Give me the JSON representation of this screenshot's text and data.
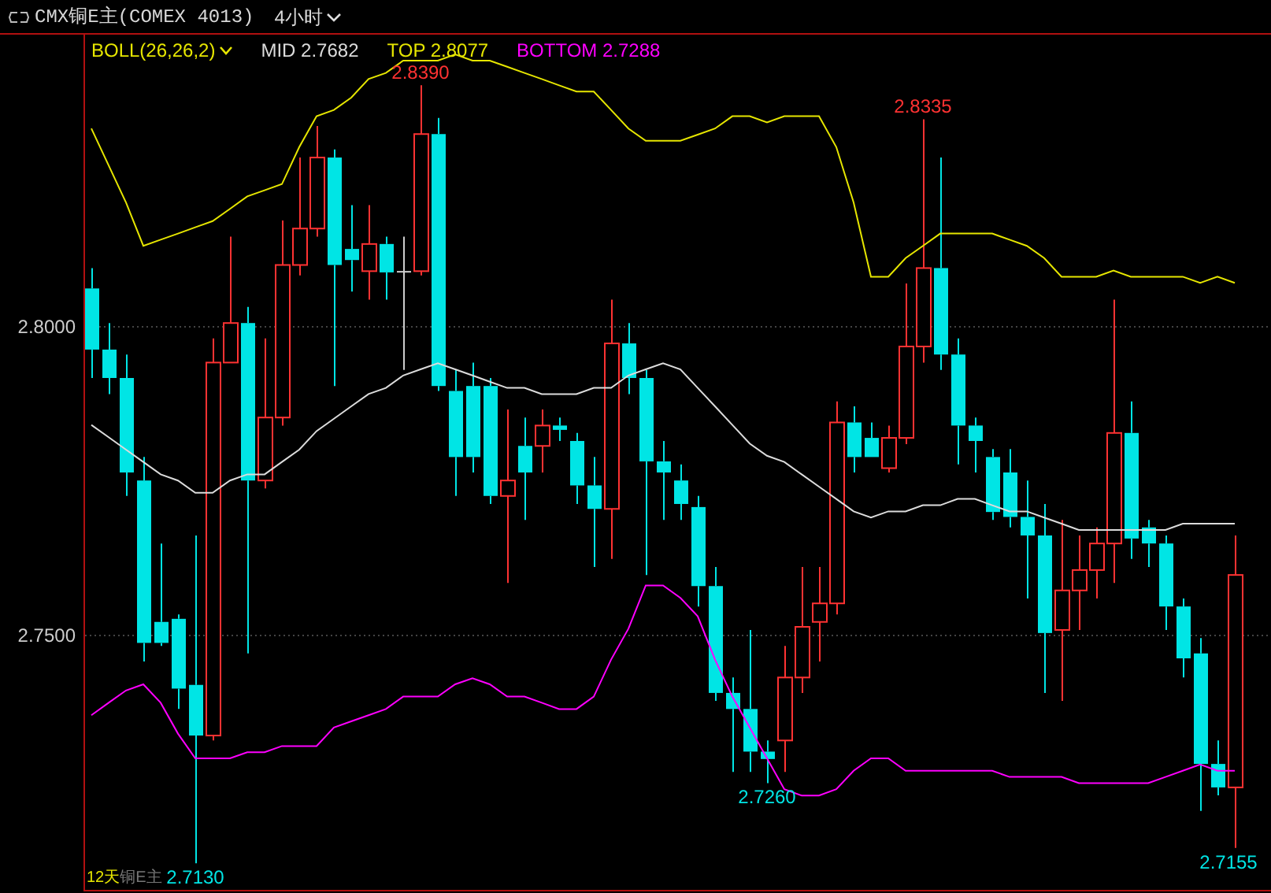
{
  "header": {
    "title": "CMX铜E主(COMEX 4013)",
    "period": "4小时"
  },
  "legend": [
    {
      "kind": "indicator",
      "text": "BOLL(26,26,2)",
      "color": "#e6e600"
    },
    {
      "kind": "value",
      "text": "MID 2.7682",
      "color": "#dcdcdc"
    },
    {
      "kind": "value",
      "text": "TOP 2.8077",
      "color": "#e6e600"
    },
    {
      "kind": "value",
      "text": "BOTTOM 2.7288",
      "color": "#ff00ff"
    }
  ],
  "chart_data": {
    "type": "candlestick",
    "ylim": [
      2.7082,
      2.8472
    ],
    "yticks": [
      {
        "value": 2.8,
        "label": "2.8000"
      },
      {
        "value": 2.75,
        "label": "2.7500"
      }
    ],
    "series": [
      {
        "type": "line",
        "color": "#dcdcdc",
        "values": [
          2.784,
          2.782,
          2.78,
          2.778,
          2.776,
          2.775,
          2.773,
          2.773,
          2.775,
          2.776,
          2.776,
          2.778,
          2.78,
          2.783,
          2.785,
          2.787,
          2.789,
          2.79,
          2.792,
          2.793,
          2.794,
          2.793,
          2.792,
          2.791,
          2.79,
          2.79,
          2.789,
          2.789,
          2.789,
          2.79,
          2.79,
          2.792,
          2.793,
          2.794,
          2.793,
          2.79,
          2.787,
          2.784,
          2.781,
          2.779,
          2.778,
          2.776,
          2.774,
          2.772,
          2.77,
          2.769,
          2.77,
          2.77,
          2.771,
          2.771,
          2.772,
          2.772,
          2.771,
          2.77,
          2.77,
          2.769,
          2.768,
          2.767,
          2.767,
          2.767,
          2.767,
          2.767,
          2.767,
          2.768,
          2.768,
          2.768,
          2.768
        ]
      },
      {
        "type": "line",
        "color": "#e6e600",
        "values": [
          2.832,
          2.826,
          2.82,
          2.813,
          2.814,
          2.815,
          2.816,
          2.817,
          2.819,
          2.821,
          2.822,
          2.823,
          2.829,
          2.834,
          2.835,
          2.837,
          2.84,
          2.841,
          2.843,
          2.843,
          2.843,
          2.844,
          2.843,
          2.843,
          2.842,
          2.841,
          2.84,
          2.839,
          2.838,
          2.838,
          2.835,
          2.832,
          2.83,
          2.83,
          2.83,
          2.831,
          2.832,
          2.834,
          2.834,
          2.833,
          2.834,
          2.834,
          2.834,
          2.829,
          2.82,
          2.808,
          2.808,
          2.811,
          2.813,
          2.815,
          2.815,
          2.815,
          2.815,
          2.814,
          2.813,
          2.811,
          2.808,
          2.808,
          2.808,
          2.809,
          2.808,
          2.808,
          2.808,
          2.808,
          2.807,
          2.808,
          2.807
        ]
      },
      {
        "type": "line",
        "color": "#ff00ff",
        "values": [
          2.737,
          2.739,
          2.741,
          2.742,
          2.739,
          2.734,
          2.73,
          2.73,
          2.73,
          2.731,
          2.731,
          2.732,
          2.732,
          2.732,
          2.735,
          2.736,
          2.737,
          2.738,
          2.74,
          2.74,
          2.74,
          2.742,
          2.743,
          2.742,
          2.74,
          2.74,
          2.739,
          2.738,
          2.738,
          2.74,
          2.746,
          2.751,
          2.758,
          2.758,
          2.756,
          2.753,
          2.746,
          2.74,
          2.735,
          2.73,
          2.725,
          2.724,
          2.724,
          2.725,
          2.728,
          2.73,
          2.73,
          2.728,
          2.728,
          2.728,
          2.728,
          2.728,
          2.728,
          2.727,
          2.727,
          2.727,
          2.727,
          2.726,
          2.726,
          2.726,
          2.726,
          2.726,
          2.727,
          2.728,
          2.729,
          2.728,
          2.728
        ]
      }
    ],
    "ohlc": [
      [
        2.8061,
        2.8094,
        2.7916,
        2.7962
      ],
      [
        2.7962,
        2.8005,
        2.789,
        2.7916
      ],
      [
        2.7916,
        2.7954,
        2.7725,
        2.7763
      ],
      [
        2.775,
        2.7788,
        2.7457,
        2.7487
      ],
      [
        2.7521,
        2.7648,
        2.7482,
        2.7487
      ],
      [
        2.7526,
        2.7533,
        2.738,
        2.7413
      ],
      [
        2.7419,
        2.7661,
        2.713,
        2.7337
      ],
      [
        2.7337,
        2.798,
        2.7329,
        2.7941
      ],
      [
        2.7941,
        2.8145,
        2.7941,
        2.8005
      ],
      [
        2.8005,
        2.8031,
        2.747,
        2.775
      ],
      [
        2.775,
        2.798,
        2.7737,
        2.7852
      ],
      [
        2.7852,
        2.8171,
        2.7839,
        2.8099
      ],
      [
        2.8099,
        2.8273,
        2.8082,
        2.8158
      ],
      [
        2.8158,
        2.8324,
        2.8145,
        2.8273
      ],
      [
        2.8273,
        2.8286,
        2.7903,
        2.8099
      ],
      [
        2.8125,
        2.8196,
        2.8056,
        2.8107
      ],
      [
        2.8089,
        2.8196,
        2.8043,
        2.8133
      ],
      [
        2.8133,
        2.8145,
        2.8043,
        2.8087
      ],
      [
        2.8088,
        2.8145,
        2.7929,
        2.8088
      ],
      [
        2.8089,
        2.839,
        2.8082,
        2.8311
      ],
      [
        2.8311,
        2.8337,
        2.7895,
        2.7903
      ],
      [
        2.7895,
        2.7929,
        2.7725,
        2.7788
      ],
      [
        2.7903,
        2.7941,
        2.7763,
        2.7788
      ],
      [
        2.7903,
        2.7916,
        2.7712,
        2.7725
      ],
      [
        2.7725,
        2.7865,
        2.7584,
        2.775
      ],
      [
        2.7806,
        2.7852,
        2.7686,
        2.7763
      ],
      [
        2.7806,
        2.7865,
        2.7763,
        2.7839
      ],
      [
        2.7839,
        2.7852,
        2.7814,
        2.7832
      ],
      [
        2.7814,
        2.7827,
        2.7712,
        2.7742
      ],
      [
        2.7742,
        2.7788,
        2.761,
        2.7704
      ],
      [
        2.7704,
        2.8043,
        2.7623,
        2.7972
      ],
      [
        2.7972,
        2.8005,
        2.789,
        2.7916
      ],
      [
        2.7916,
        2.7929,
        2.7597,
        2.7781
      ],
      [
        2.7781,
        2.7814,
        2.7686,
        2.7763
      ],
      [
        2.775,
        2.7776,
        2.7686,
        2.7712
      ],
      [
        2.7707,
        2.7725,
        2.7546,
        2.7579
      ],
      [
        2.7579,
        2.761,
        2.7393,
        2.7406
      ],
      [
        2.7406,
        2.7431,
        2.7278,
        2.738
      ],
      [
        2.738,
        2.7508,
        2.7278,
        2.7311
      ],
      [
        2.7311,
        2.7329,
        2.726,
        2.7299
      ],
      [
        2.7329,
        2.7482,
        2.7278,
        2.7431
      ],
      [
        2.7431,
        2.761,
        2.7406,
        2.7513
      ],
      [
        2.7521,
        2.761,
        2.7457,
        2.7551
      ],
      [
        2.7551,
        2.7878,
        2.7533,
        2.7844
      ],
      [
        2.7844,
        2.787,
        2.7763,
        2.7788
      ],
      [
        2.7819,
        2.7844,
        2.7788,
        2.7788
      ],
      [
        2.777,
        2.7839,
        2.7763,
        2.7819
      ],
      [
        2.7819,
        2.8069,
        2.7809,
        2.7967
      ],
      [
        2.7967,
        2.8335,
        2.7941,
        2.8094
      ],
      [
        2.8094,
        2.8273,
        2.7929,
        2.7954
      ],
      [
        2.7954,
        2.798,
        2.7776,
        2.7839
      ],
      [
        2.7839,
        2.7852,
        2.7763,
        2.7814
      ],
      [
        2.7788,
        2.7801,
        2.7686,
        2.7699
      ],
      [
        2.7763,
        2.7801,
        2.7674,
        2.7691
      ],
      [
        2.7691,
        2.775,
        2.7559,
        2.7661
      ],
      [
        2.7661,
        2.7712,
        2.7406,
        2.7503
      ],
      [
        2.7508,
        2.7686,
        2.7393,
        2.7572
      ],
      [
        2.7572,
        2.7661,
        2.7508,
        2.7605
      ],
      [
        2.7605,
        2.7674,
        2.7559,
        2.7648
      ],
      [
        2.7648,
        2.8043,
        2.7584,
        2.7827
      ],
      [
        2.7827,
        2.7878,
        2.7623,
        2.7656
      ],
      [
        2.7674,
        2.7686,
        2.761,
        2.7648
      ],
      [
        2.7648,
        2.7661,
        2.7508,
        2.7546
      ],
      [
        2.7546,
        2.7559,
        2.7431,
        2.7462
      ],
      [
        2.747,
        2.7495,
        2.7215,
        2.7291
      ],
      [
        2.7291,
        2.7329,
        2.724,
        2.7253
      ],
      [
        2.7253,
        2.7661,
        2.7155,
        2.7597
      ]
    ],
    "annotations": [
      {
        "y": 2.839,
        "text": "2.8390"
      },
      {
        "y": 2.8335,
        "text": "2.8335"
      },
      {
        "y": 2.726,
        "text": "2.7260"
      },
      {
        "y": 2.713,
        "text": "2.7130"
      },
      {
        "y": 2.7155,
        "text": "2.7155"
      }
    ]
  },
  "footer": {
    "period": "12天",
    "symbol": "铜E主"
  }
}
